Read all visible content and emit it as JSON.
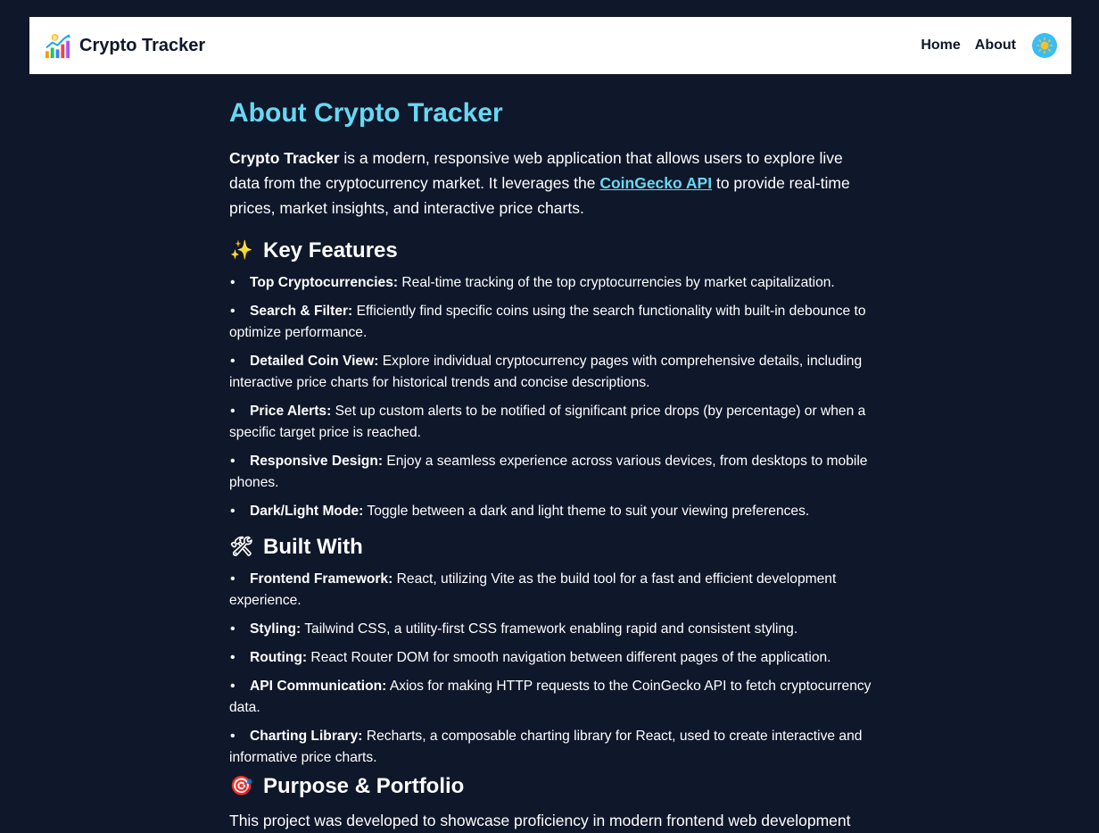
{
  "navbar": {
    "brand": "Crypto Tracker",
    "links": [
      "Home",
      "About"
    ],
    "theme_icon": "sun-icon",
    "colors": {
      "background": "#ffffff",
      "toggle": "#38bdf8"
    }
  },
  "page": {
    "title": "About Crypto Tracker",
    "intro_bold": "Crypto Tracker",
    "intro_text_1": " is a modern, responsive web application that allows users to explore live data from the cryptocurrency market. It leverages the ",
    "intro_link": "CoinGecko API",
    "intro_text_2": " to provide real-time prices, market insights, and interactive price charts."
  },
  "features": {
    "heading": "Key Features",
    "icon": "sparkles-icon",
    "items": [
      {
        "label": "Top Cryptocurrencies:",
        "text": " Real-time tracking of the top cryptocurrencies by market capitalization."
      },
      {
        "label": "Search & Filter:",
        "text": " Efficiently find specific coins using the search functionality with built-in debounce to optimize performance."
      },
      {
        "label": "Detailed Coin View:",
        "text": " Explore individual cryptocurrency pages with comprehensive details, including interactive price charts for historical trends and concise descriptions."
      },
      {
        "label": "Price Alerts:",
        "text": " Set up custom alerts to be notified of significant price drops (by percentage) or when a specific target price is reached."
      },
      {
        "label": "Responsive Design:",
        "text": " Enjoy a seamless experience across various devices, from desktops to mobile phones."
      },
      {
        "label": "Dark/Light Mode:",
        "text": " Toggle between a dark and light theme to suit your viewing preferences."
      }
    ]
  },
  "built_with": {
    "heading": "Built With",
    "icon": "hammer-wrench-icon",
    "items": [
      {
        "label": "Frontend Framework:",
        "text": " React, utilizing Vite as the build tool for a fast and efficient development experience."
      },
      {
        "label": "Styling:",
        "text": " Tailwind CSS, a utility-first CSS framework enabling rapid and consistent styling."
      },
      {
        "label": "Routing:",
        "text": " React Router DOM for smooth navigation between different pages of the application."
      },
      {
        "label": "API Communication:",
        "text": " Axios for making HTTP requests to the CoinGecko API to fetch cryptocurrency data."
      },
      {
        "label": "Charting Library:",
        "text": " Recharts, a composable charting library for React, used to create interactive and informative price charts."
      }
    ]
  },
  "purpose": {
    "heading": "Purpose & Portfolio",
    "icon": "target-icon",
    "text": "This project was developed to showcase proficiency in modern frontend web development"
  },
  "colors": {
    "page_background": "#0f172a",
    "accent": "#67d8f3",
    "text": "#ffffff"
  }
}
